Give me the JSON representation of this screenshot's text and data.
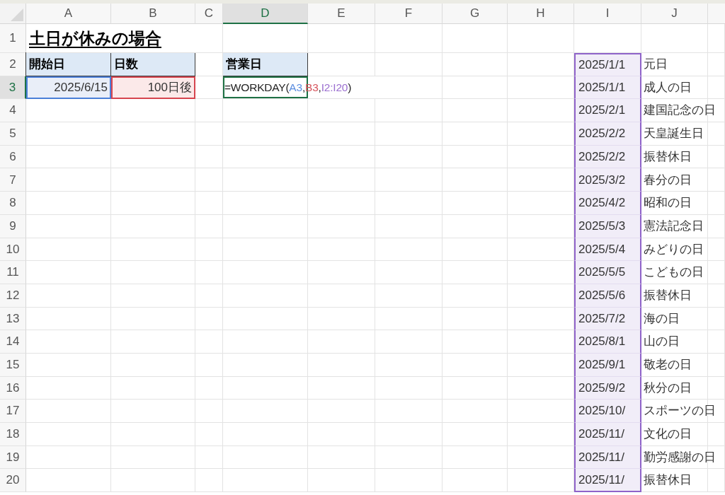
{
  "columns": [
    {
      "label": "A",
      "selected": false
    },
    {
      "label": "B",
      "selected": false
    },
    {
      "label": "C",
      "selected": false
    },
    {
      "label": "D",
      "selected": true
    },
    {
      "label": "E",
      "selected": false
    },
    {
      "label": "F",
      "selected": false
    },
    {
      "label": "G",
      "selected": false
    },
    {
      "label": "H",
      "selected": false
    },
    {
      "label": "I",
      "selected": false
    },
    {
      "label": "J",
      "selected": false
    }
  ],
  "rows": [
    {
      "number": "1",
      "selected": false,
      "title": "土日が休みの場合"
    },
    {
      "number": "2",
      "selected": false,
      "start_header": "開始日",
      "days_header": "日数",
      "result_header": "営業日",
      "holiday_date": "2025/1/1",
      "holiday_name": "元日"
    },
    {
      "number": "3",
      "selected": true,
      "start_date": "2025/6/15",
      "days": "100日後",
      "formula": [
        {
          "text": "=WORKDAY("
        },
        {
          "text": "A3",
          "color": "#5b8ee0"
        },
        {
          "text": ","
        },
        {
          "text": "B3",
          "color": "#d6545c"
        },
        {
          "text": ","
        },
        {
          "text": "I2:I20",
          "color": "#9b6fd0"
        },
        {
          "text": ")"
        }
      ],
      "holiday_date": "2025/1/1",
      "holiday_name": "成人の日"
    },
    {
      "number": "4",
      "selected": false,
      "holiday_date": "2025/2/1",
      "holiday_name": "建国記念の日"
    },
    {
      "number": "5",
      "selected": false,
      "holiday_date": "2025/2/2",
      "holiday_name": "天皇誕生日"
    },
    {
      "number": "6",
      "selected": false,
      "holiday_date": "2025/2/2",
      "holiday_name": "振替休日"
    },
    {
      "number": "7",
      "selected": false,
      "holiday_date": "2025/3/2",
      "holiday_name": "春分の日"
    },
    {
      "number": "8",
      "selected": false,
      "holiday_date": "2025/4/2",
      "holiday_name": "昭和の日"
    },
    {
      "number": "9",
      "selected": false,
      "holiday_date": "2025/5/3",
      "holiday_name": "憲法記念日"
    },
    {
      "number": "10",
      "selected": false,
      "holiday_date": "2025/5/4",
      "holiday_name": "みどりの日"
    },
    {
      "number": "11",
      "selected": false,
      "holiday_date": "2025/5/5",
      "holiday_name": "こどもの日"
    },
    {
      "number": "12",
      "selected": false,
      "holiday_date": "2025/5/6",
      "holiday_name": "振替休日"
    },
    {
      "number": "13",
      "selected": false,
      "holiday_date": "2025/7/2",
      "holiday_name": "海の日"
    },
    {
      "number": "14",
      "selected": false,
      "holiday_date": "2025/8/1",
      "holiday_name": "山の日"
    },
    {
      "number": "15",
      "selected": false,
      "holiday_date": "2025/9/1",
      "holiday_name": "敬老の日"
    },
    {
      "number": "16",
      "selected": false,
      "holiday_date": "2025/9/2",
      "holiday_name": "秋分の日"
    },
    {
      "number": "17",
      "selected": false,
      "holiday_date": "2025/10/",
      "holiday_name": "スポーツの日"
    },
    {
      "number": "18",
      "selected": false,
      "holiday_date": "2025/11/",
      "holiday_name": "文化の日"
    },
    {
      "number": "19",
      "selected": false,
      "holiday_date": "2025/11/",
      "holiday_name": "勤労感謝の日"
    },
    {
      "number": "20",
      "selected": false,
      "holiday_date": "2025/11/",
      "holiday_name": "振替休日"
    }
  ]
}
